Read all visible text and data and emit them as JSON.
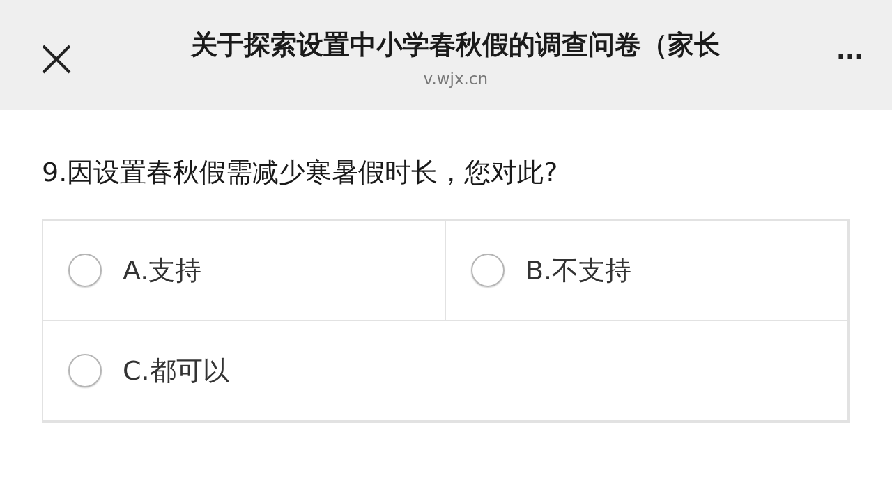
{
  "header": {
    "title": "关于探索设置中小学春秋假的调查问卷（家长",
    "url": "v.wjx.cn",
    "more": "..."
  },
  "question": {
    "title": "9.因设置春秋假需减少寒暑假时长，您对此?",
    "options": [
      {
        "label": "A.支持",
        "selected": false
      },
      {
        "label": "B.不支持",
        "selected": false
      },
      {
        "label": "C.都可以",
        "selected": false
      }
    ]
  }
}
